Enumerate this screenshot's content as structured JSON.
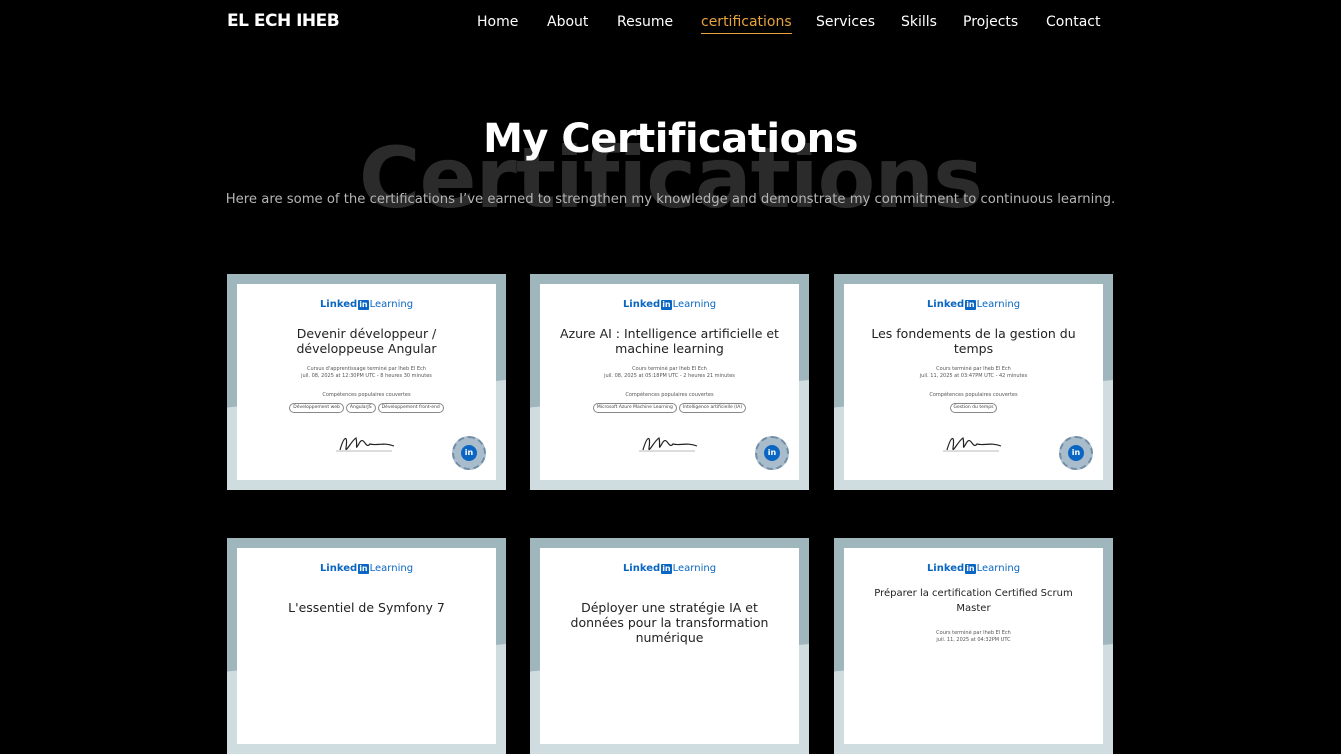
{
  "nav": {
    "logo": "EL ECH IHEB",
    "items": [
      {
        "label": "Home"
      },
      {
        "label": "About"
      },
      {
        "label": "Resume"
      },
      {
        "label": "certifications"
      },
      {
        "label": "Services"
      },
      {
        "label": "Skills"
      },
      {
        "label": "Projects"
      },
      {
        "label": "Contact"
      }
    ],
    "active_color": "#e8a33d"
  },
  "header": {
    "bg_title": "Certifications",
    "title": "My Certifications",
    "subtitle": "Here are some of the certifications I’ve earned to strengthen my knowledge and demonstrate my commitment to continuous learning."
  },
  "brand": {
    "linked": "Linked",
    "in": "in",
    "learning": "Learning"
  },
  "certs": [
    {
      "title": "Devenir développeur / développeuse Angular",
      "meta1": "Cursus d'apprentissage terminé par Iheb El Ech",
      "meta2": "juil. 08, 2025 at 12:30PM UTC - 8 heures 30 minutes",
      "skills_label": "Compétences populaires couvertes",
      "skills": [
        "Développement web",
        "AngularJS",
        "Développement front-end"
      ]
    },
    {
      "title": "Azure AI : Intelligence artificielle et machine learning",
      "meta1": "Cours terminé par Iheb El Ech",
      "meta2": "juil. 08, 2025 at 05:18PM UTC - 2 heures 21 minutes",
      "skills_label": "Compétences populaires couvertes",
      "skills": [
        "Microsoft Azure Machine Learning",
        "Intelligence artificielle (IA)"
      ]
    },
    {
      "title": "Les fondements de la gestion du temps",
      "meta1": "Cours terminé par Iheb El Ech",
      "meta2": "juil. 11, 2025 at 03:47PM UTC - 42 minutes",
      "skills_label": "Compétences populaires couvertes",
      "skills": [
        "Gestion du temps"
      ]
    },
    {
      "title": "L'essentiel de Symfony 7",
      "meta1": "",
      "meta2": "",
      "skills_label": "",
      "skills": []
    },
    {
      "title": "Déployer une stratégie IA et données pour la transformation numérique",
      "meta1": "",
      "meta2": "",
      "skills_label": "",
      "skills": []
    },
    {
      "title": "Préparer la certification Certified Scrum Master",
      "meta1": "Cours terminé par Iheb El Ech",
      "meta2": "juil. 11, 2025 at 04:32PM UTC",
      "skills_label": "",
      "skills": []
    }
  ],
  "colors": {
    "page_bg": "#000000",
    "card_frame": "#9fb6bd",
    "linkedin_blue": "#0a66c2"
  }
}
